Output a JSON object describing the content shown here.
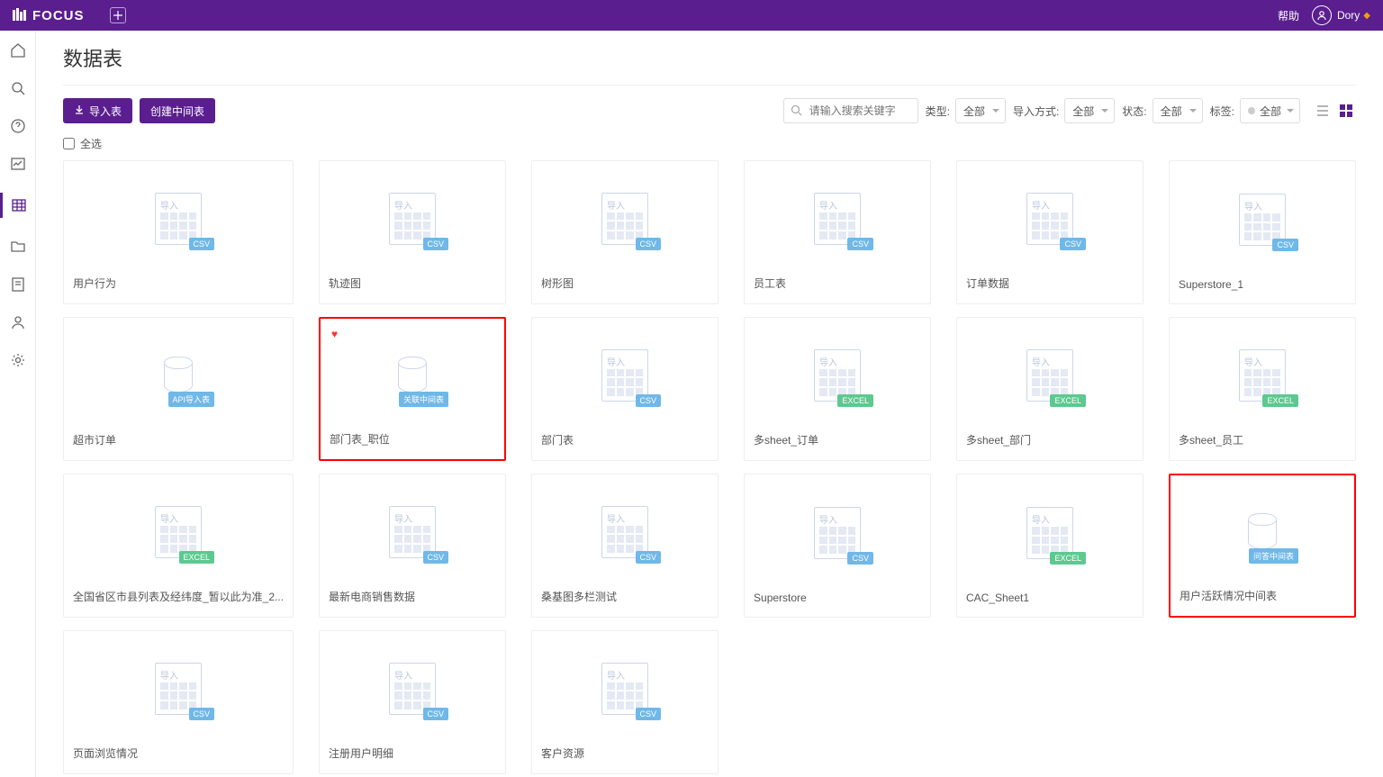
{
  "topbar": {
    "brand": "FOCUS",
    "help": "帮助",
    "user": "Dory"
  },
  "page": {
    "title": "数据表",
    "import_btn": "导入表",
    "create_btn": "创建中间表",
    "search_placeholder": "请输入搜索关键字",
    "select_all": "全选"
  },
  "filters": {
    "type_label": "类型:",
    "type_value": "全部",
    "import_label": "导入方式:",
    "import_value": "全部",
    "status_label": "状态:",
    "status_value": "全部",
    "tag_label": "标签:",
    "tag_value": "全部"
  },
  "thumb_label": "导入",
  "cards": [
    {
      "title": "用户行为",
      "badge": "CSV",
      "icon": "sheet",
      "highlight": false,
      "heart": false
    },
    {
      "title": "轨迹图",
      "badge": "CSV",
      "icon": "sheet",
      "highlight": false,
      "heart": false
    },
    {
      "title": "树形图",
      "badge": "CSV",
      "icon": "sheet",
      "highlight": false,
      "heart": false
    },
    {
      "title": "员工表",
      "badge": "CSV",
      "icon": "sheet",
      "highlight": false,
      "heart": false
    },
    {
      "title": "订单数据",
      "badge": "CSV",
      "icon": "sheet",
      "highlight": false,
      "heart": false
    },
    {
      "title": "Superstore_1",
      "badge": "CSV",
      "icon": "sheet",
      "highlight": false,
      "heart": false
    },
    {
      "title": "超市订单",
      "badge": "API导入表",
      "icon": "db",
      "highlight": false,
      "heart": false
    },
    {
      "title": "部门表_职位",
      "badge": "关联中间表",
      "icon": "db",
      "highlight": true,
      "heart": true
    },
    {
      "title": "部门表",
      "badge": "CSV",
      "icon": "sheet",
      "highlight": false,
      "heart": false
    },
    {
      "title": "多sheet_订单",
      "badge": "EXCEL",
      "icon": "sheet",
      "highlight": false,
      "heart": false
    },
    {
      "title": "多sheet_部门",
      "badge": "EXCEL",
      "icon": "sheet",
      "highlight": false,
      "heart": false
    },
    {
      "title": "多sheet_员工",
      "badge": "EXCEL",
      "icon": "sheet",
      "highlight": false,
      "heart": false
    },
    {
      "title": "全国省区市县列表及经纬度_暂以此为准_2...",
      "badge": "EXCEL",
      "icon": "sheet",
      "highlight": false,
      "heart": false
    },
    {
      "title": "最新电商销售数据",
      "badge": "CSV",
      "icon": "sheet",
      "highlight": false,
      "heart": false
    },
    {
      "title": "桑基图多栏测试",
      "badge": "CSV",
      "icon": "sheet",
      "highlight": false,
      "heart": false
    },
    {
      "title": "Superstore",
      "badge": "CSV",
      "icon": "sheet",
      "highlight": false,
      "heart": false
    },
    {
      "title": "CAC_Sheet1",
      "badge": "EXCEL",
      "icon": "sheet",
      "highlight": false,
      "heart": false
    },
    {
      "title": "用户活跃情况中间表",
      "badge": "问答中间表",
      "icon": "db",
      "highlight": true,
      "heart": false
    },
    {
      "title": "页面浏览情况",
      "badge": "CSV",
      "icon": "sheet",
      "highlight": false,
      "heart": false
    },
    {
      "title": "注册用户明细",
      "badge": "CSV",
      "icon": "sheet",
      "highlight": false,
      "heart": false
    },
    {
      "title": "客户资源",
      "badge": "CSV",
      "icon": "sheet",
      "highlight": false,
      "heart": false
    }
  ]
}
